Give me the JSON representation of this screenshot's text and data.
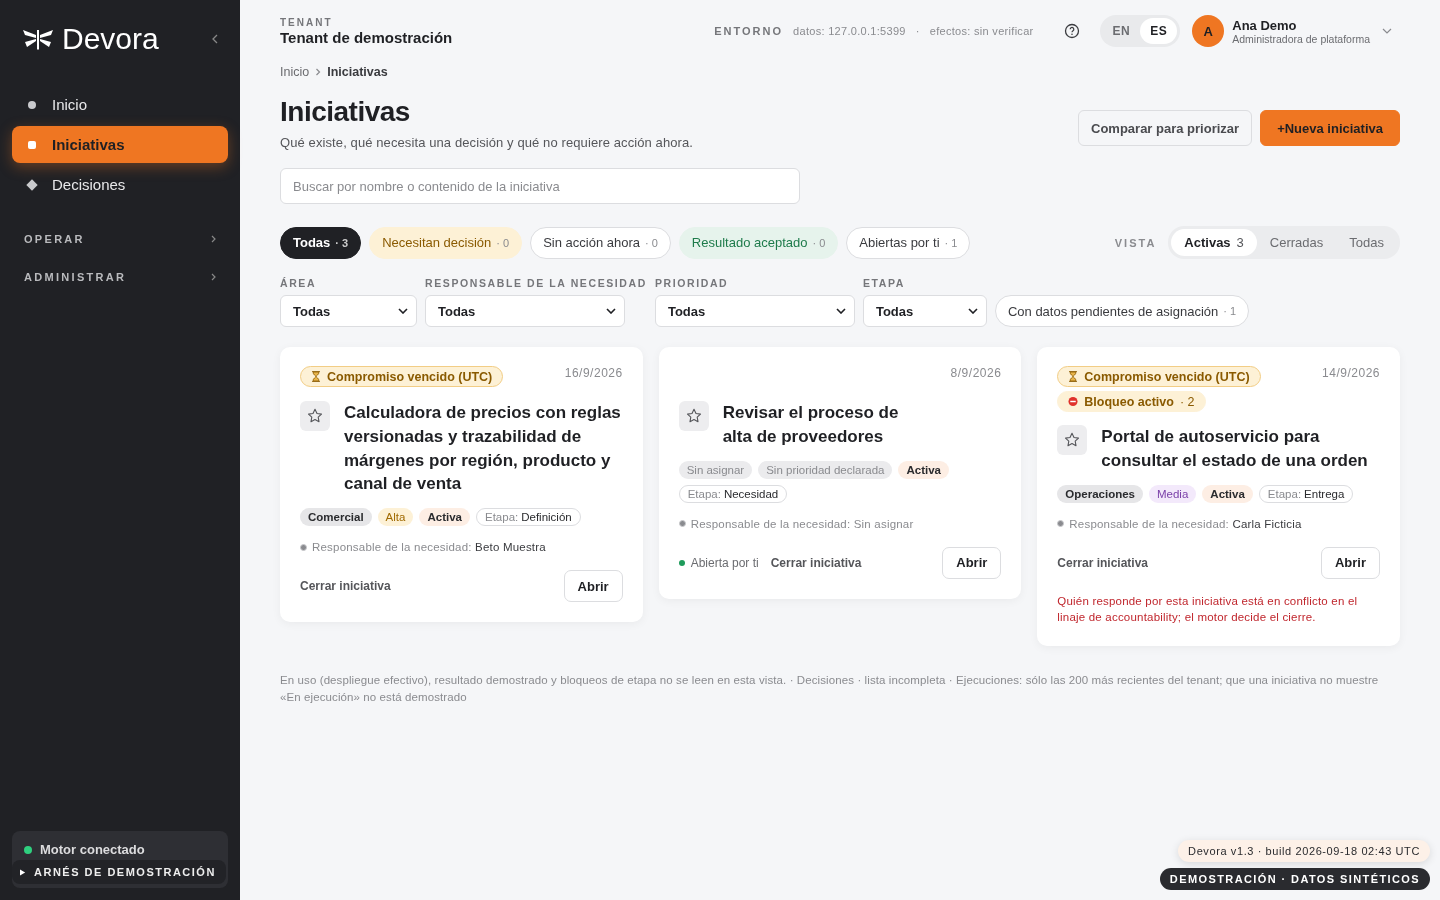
{
  "sidebar": {
    "logo": "Devora",
    "nav": [
      {
        "label": "Inicio",
        "kind": "dot",
        "selected": false
      },
      {
        "label": "Iniciativas",
        "kind": "square",
        "selected": true
      },
      {
        "label": "Decisiones",
        "kind": "diamond",
        "selected": false
      }
    ],
    "sections": [
      {
        "label": "OPERAR"
      },
      {
        "label": "ADMINISTRAR"
      }
    ],
    "engine": {
      "label": "Motor conectado",
      "on": true
    },
    "harness": {
      "label": "ARNÉS DE DEMOSTRACIÓN",
      "expanded": false
    }
  },
  "header": {
    "tenant_label": "TENANT",
    "tenant_name": "Tenant de demostración",
    "env_label": "ENTORNO",
    "env_data": "datos: 127.0.0.1:5399",
    "env_sep": "·",
    "env_effects": "efectos: sin verificar",
    "languages": [
      {
        "label": "EN",
        "selected": false
      },
      {
        "label": "ES",
        "selected": true
      }
    ],
    "user": {
      "initial": "A",
      "name": "Ana Demo",
      "role": "Administradora de plataforma"
    }
  },
  "breadcrumb": [
    "Inicio",
    "Iniciativas"
  ],
  "page": {
    "title": "Iniciativas",
    "subtitle": "Qué existe, qué necesita una decisión y qué no requiere acción ahora.",
    "actions": [
      {
        "label": "Comparar para priorizar",
        "kind": "secondary"
      },
      {
        "label": "+Nueva iniciativa",
        "kind": "primary"
      }
    ]
  },
  "search": {
    "placeholder": "Buscar por nombre o contenido de la iniciativa"
  },
  "filters": [
    {
      "label": "Todas",
      "count": "· 3",
      "kind": "neutral",
      "selected": true
    },
    {
      "label": "Necesitan decisión",
      "count": "· 0",
      "kind": "warning",
      "selected": false
    },
    {
      "label": "Sin acción ahora",
      "count": "· 0",
      "kind": "neutral",
      "selected": false
    },
    {
      "label": "Resultado aceptado",
      "count": "· 0",
      "kind": "success",
      "selected": false
    },
    {
      "label": "Abiertas por ti",
      "count": "· 1",
      "kind": "neutral",
      "selected": false
    }
  ],
  "view": {
    "label": "VISTA",
    "options": [
      {
        "label": "Activas",
        "count": "3",
        "selected": true
      },
      {
        "label": "Cerradas",
        "selected": false
      },
      {
        "label": "Todas",
        "selected": false
      }
    ]
  },
  "dropdowns": [
    {
      "label": "ÁREA",
      "value": "Todas"
    },
    {
      "label": "RESPONSABLE DE LA NECESIDAD",
      "value": "Todas"
    },
    {
      "label": "PRIORIDAD",
      "value": "Todas"
    },
    {
      "label": "ETAPA",
      "value": "Todas"
    }
  ],
  "pending_chip": {
    "label": "Con datos pendientes de asignación",
    "count": "· 1"
  },
  "cards": [
    {
      "badges": [
        {
          "kind": "overdue",
          "label": "Compromiso vencido (UTC)"
        }
      ],
      "date": "16/9/2026",
      "title": "Calculadora de precios con reglas versionadas y trazabilidad de márgenes por región, producto y canal de venta",
      "starred": false,
      "tags": [
        {
          "label": "Comercial",
          "kind": "area"
        },
        {
          "label": "Alta",
          "kind": "high"
        },
        {
          "label": "Activa",
          "kind": "status"
        },
        {
          "prefix": "Etapa:",
          "label": "Definición",
          "kind": "stage"
        }
      ],
      "owner_label": "Responsable de la necesidad:",
      "owner": "Beto Muestra",
      "assigned": true,
      "close_label": "Cerrar iniciativa",
      "open_label": "Abrir"
    },
    {
      "date": "8/9/2026",
      "title": "Revisar el proceso de alta de proveedores",
      "starred": false,
      "tags": [
        {
          "label": "Sin asignar",
          "kind": "muted"
        },
        {
          "label": "Sin prioridad declarada",
          "kind": "muted"
        },
        {
          "label": "Activa",
          "kind": "status"
        },
        {
          "prefix": "Etapa:",
          "label": "Necesidad",
          "kind": "stage"
        }
      ],
      "owner_label": "Responsable de la necesidad:",
      "owner": "Sin asignar",
      "assigned": false,
      "opened_by_you": "Abierta por ti",
      "close_label": "Cerrar iniciativa",
      "open_label": "Abrir"
    },
    {
      "badges": [
        {
          "kind": "overdue",
          "label": "Compromiso vencido (UTC)"
        },
        {
          "kind": "blocked",
          "label": "Bloqueo activo",
          "count": "· 2"
        }
      ],
      "date": "14/9/2026",
      "title": "Portal de autoservicio para consultar el estado de una orden",
      "starred": false,
      "tags": [
        {
          "label": "Operaciones",
          "kind": "area"
        },
        {
          "label": "Media",
          "kind": "medium"
        },
        {
          "label": "Activa",
          "kind": "status"
        },
        {
          "prefix": "Etapa:",
          "label": "Entrega",
          "kind": "stage"
        }
      ],
      "owner_label": "Responsable de la necesidad:",
      "owner": "Carla Ficticia",
      "assigned": true,
      "close_label": "Cerrar iniciativa",
      "open_label": "Abrir",
      "warning": "Quién responde por esta iniciativa está en conflicto en el linaje de accountability; el motor decide el cierre."
    }
  ],
  "footnote": "En uso (despliegue efectivo), resultado demostrado y bloqueos de etapa no se leen en esta vista. · Decisiones · lista incompleta · Ejecuciones: sólo las 200 más recientes del tenant; que una iniciativa no muestre «En ejecución» no está demostrado",
  "build": "Devora v1.3 · build 2026-09-18 02:43 UTC",
  "demo_badge": "DEMOSTRACIÓN · DATOS SINTÉTICOS"
}
